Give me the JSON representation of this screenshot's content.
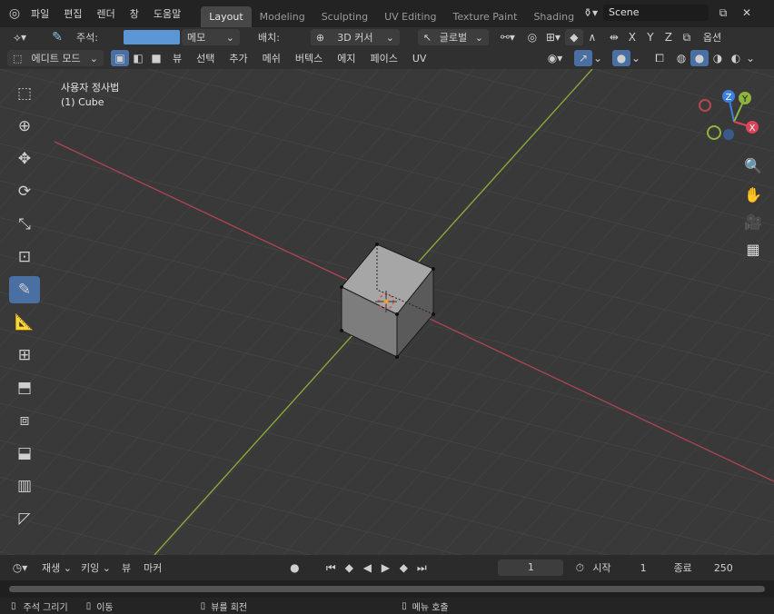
{
  "menu": {
    "items": [
      "파일",
      "편집",
      "렌더",
      "창",
      "도움말"
    ]
  },
  "workspace_tabs": [
    "Layout",
    "Modeling",
    "Sculpting",
    "UV Editing",
    "Texture Paint",
    "Shading"
  ],
  "scene": {
    "name": "Scene"
  },
  "header1": {
    "annotate_label": "주석:",
    "annotate_color": "#5b96d6",
    "note_label": "메모",
    "placement_label": "배치:",
    "placement_value": "3D 커서",
    "orientation_value": "글로벌",
    "axis_x": "X",
    "axis_y": "Y",
    "axis_z": "Z",
    "options_label": "옵션"
  },
  "header2": {
    "mode_label": "에디트 모드",
    "menus": [
      "뷰",
      "선택",
      "추가",
      "메쉬",
      "버텍스",
      "에지",
      "페이스",
      "UV"
    ]
  },
  "viewport": {
    "view_name": "사용자 정사법",
    "object_name": "(1) Cube"
  },
  "gizmo": {
    "x": "X",
    "y": "Y",
    "z": "Z"
  },
  "timeline": {
    "playback_label": "재생",
    "keying_label": "키잉",
    "view_label": "뷰",
    "marker_label": "마커",
    "current_frame": "1",
    "start_label": "시작",
    "start_value": "1",
    "end_label": "종료",
    "end_value": "250"
  },
  "status": {
    "hint1": "주석 그리기",
    "hint2": "이동",
    "hint3": "뷰를 회전",
    "hint4": "메뉴 호출"
  },
  "colors": {
    "accent": "#4a6fa3",
    "x_axis": "#b8474f",
    "y_axis": "#8fb33c",
    "z_axis": "#3b7fe0"
  }
}
